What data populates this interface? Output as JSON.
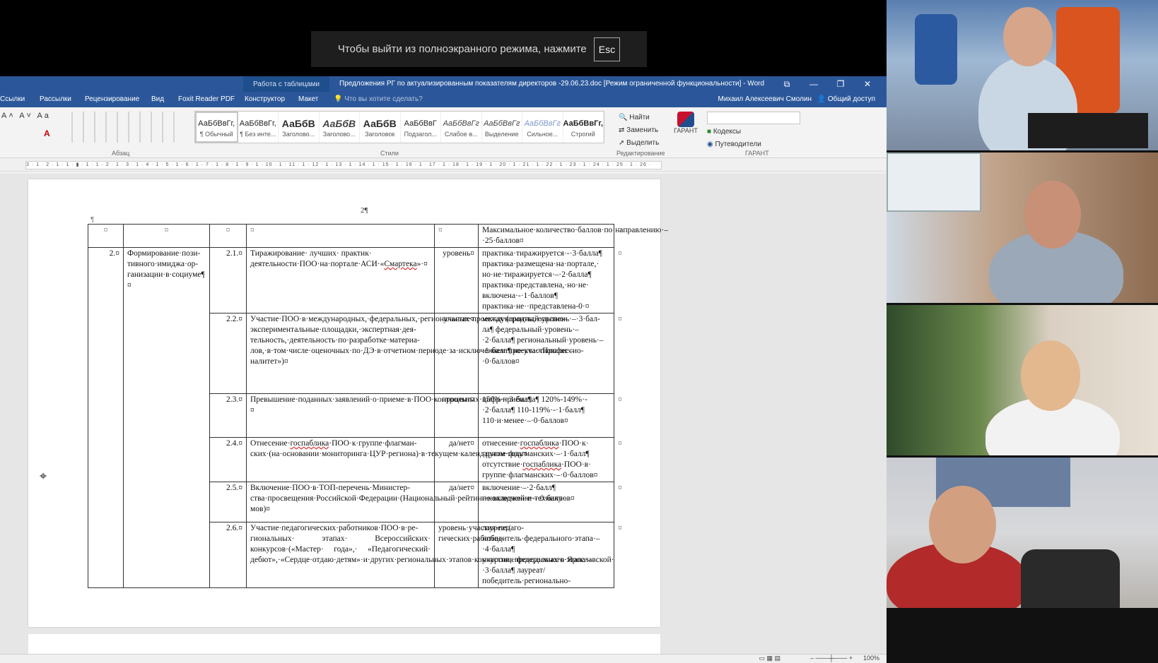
{
  "fullscreen_banner": {
    "text": "Чтобы выйти из полноэкранного режима, нажмите",
    "key": "Esc"
  },
  "word": {
    "context_tab": "Работа с таблицами",
    "title": "Предложения РГ по актуализированным показателям директоров -29.06.23.doc [Режим ограниченной функциональности] - Word",
    "window_buttons": [
      "⧉",
      "—",
      "❐",
      "✕"
    ],
    "tabs": [
      "Ссылки",
      "Рассылки",
      "Рецензирование",
      "Вид",
      "Foxit Reader PDF",
      "Конструктор",
      "Макет"
    ],
    "tell_me": "Что вы хотите сделать?",
    "user": "Михаил Алексеевич Смолин",
    "share": "Общий доступ",
    "ribbon": {
      "font_labels": [
        "A˄",
        "A˅",
        "Aa",
        "A"
      ],
      "paragraph_group": "Абзац",
      "styles_group": "Стили",
      "editing_group": "Редактирование",
      "garant_group": "ГАРАНТ",
      "styles": [
        {
          "sample": "АаБбВвГг,",
          "name": "¶ Обычный"
        },
        {
          "sample": "АаБбВвГг,",
          "name": "¶ Без инте..."
        },
        {
          "sample": "АаБбВ",
          "name": "Заголово..."
        },
        {
          "sample": "АаБбВ",
          "name": "Заголово..."
        },
        {
          "sample": "АаБбВ",
          "name": "Заголовок"
        },
        {
          "sample": "АаБбВвГ",
          "name": "Подзагол..."
        },
        {
          "sample": "АаБбВвГг",
          "name": "Слабое в..."
        },
        {
          "sample": "АаБбВвГг",
          "name": "Выделение"
        },
        {
          "sample": "АаБбВвГг",
          "name": "Сильное..."
        },
        {
          "sample": "АаБбВвГг,",
          "name": "Строгий"
        }
      ],
      "find": "Найти",
      "replace": "Заменить",
      "select": "Выделить",
      "garant_label": "ГАРАНТ",
      "codex": "Кодексы",
      "guides": "Путеводители"
    },
    "ruler_text": "3 · 1 · 2 · 1 · 1 · ▮ · 1 · 1 · 2 · 1 · 3 · 1 · 4 · 1 · 5 · 1 · 6 · 1 · 7 · 1 · 8 · 1 · 9 · 1 · 10 · 1 · 11 · 1 · 12 · 1 · 13 · 1 · 14 · 1 · 15 · 1 · 16 · 1 · 17 · 1 · 18 · 1 · 19 · 1 · 20 · 1 · 21 · 1 · 22 · 1 · 23 · 1 · 24 · 1 · 25 · 1 · 26 ·",
    "page_number": "2¶",
    "pilcrow": "¶",
    "zoom": "100%"
  },
  "table": {
    "header": [
      "¤",
      "¤",
      "¤",
      "¤",
      "¤",
      "Максимальное·количество·баллов·по·направлению·–·25·баллов¤"
    ],
    "group_num": "2.¤",
    "group_title": "Формирование·пози-тивного·имиджа·ор-ганизации·в·социуме¶ ¤",
    "rows": [
      {
        "num": "2.1.¤",
        "text_pre": "Тиражирование· лучших· практик· деятельности·ПОО·на·портале·АСИ·«",
        "text_ul": "Смартека",
        "text_post": "»·¤",
        "unit": "уровень¤",
        "score": "практика·тиражируется·-·3·балла¶ практика·размещена·на·портале,· но·не·тиражируется·–·2·балла¶ практика·представлена,·но·не· включена·-·1·баллов¶ практика·не··представлена-0·¤"
      },
      {
        "num": "2.2.¤",
        "text": "Участие·ПОО·в·международных,·федеральных,·региональных·проектах·(гранты,·опытно-экспериментальные·площадки,·экспертная·дея-тельность,·деятельность·по·разработке·материа-лов,·в·том·числе·оценочных·по·ДЭ·в·отчетном·периоде·за·исключением·проекта·«Профессио-налитет»)¤",
        "unit": "участие¤",
        "score": "международный·уровень·–·3·бал-ла¶ федеральный·уровень·–·2·балла¶ региональный·уровень·–·1·балл¶ не·участвовали·–·0·баллов¤"
      },
      {
        "num": "2.3.¤",
        "text": "Превышение·поданных·заявлений·о·приеме·в·ПОО·контрольных·цифр·приёма¶ ¤",
        "unit": "процент¤",
        "score": "150%·-·3·балла¶ 120%-149%·-·2·балла¶ 110-119%·-·1·балл¶ 110·и·менее·–·0·баллов¤"
      },
      {
        "num": "2.4.¤",
        "text_pre": "Отнесение·",
        "text_ul": "госпаблика",
        "text_post": "·ПОО·к·группе·флагман-ских·(на·основании·мониторинга·ЦУР·региона)·в·текущем·календарном·году¤",
        "unit": "да/нет¤",
        "score_pre": "отнесение·",
        "score_ul": "госпаблика",
        "score_mid": "·ПОО·к· группе·флагманских·–·1·балл¶ отсутствие·",
        "score_ul2": "госпаблика",
        "score_post": "·ПОО·в· группе·флагманских·–·0·баллов¤"
      },
      {
        "num": "2.5.¤",
        "text": "Включение·ПОО·в·ТОП-перечень·Министер-ства·просвещения·Российской·Федерации·(Национальный·рейтинг·колледжей·и·технику-мов)¤",
        "unit": "да/нет¤",
        "score": "включение·–·2·балл¶ не·включение·–·0·баллов¤"
      },
      {
        "num": "2.6.¤",
        "text": "Участие·педагогических·работников·ПОО·в·ре-гиональных· этапах· Всероссийских· конкурсов·(«Мастер· года»,· «Педагогический· дебют»,·«Сердце·отдаю·детям»·и·других·региональных·этапов·конкурсов,·проводимых·в·Ярославской·",
        "unit": "уровень·участия·педаго-гических·работни-",
        "score": "лауреат/победитель·федерального·этапа·–·4·балла¶ участник·федерального·этапа·–·3·балла¶ лауреат/победитель·регионально-"
      }
    ],
    "end_mark": "¤"
  },
  "video": {
    "participants": 4
  }
}
